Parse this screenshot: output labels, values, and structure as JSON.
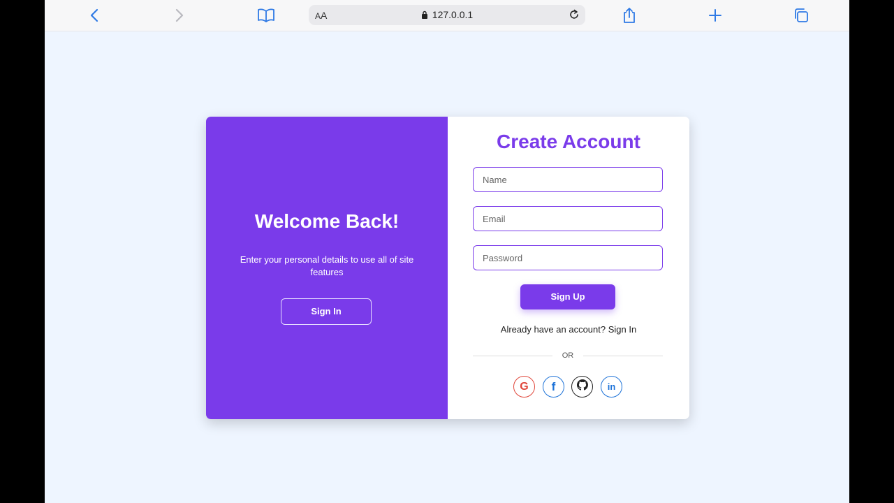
{
  "browser": {
    "address_size_small": "A",
    "address_size_big": "A",
    "url": "127.0.0.1",
    "icons": [
      "chevron-left-icon",
      "chevron-right-icon",
      "book-icon",
      "lock-icon",
      "reload-icon",
      "share-icon",
      "plus-icon",
      "tabs-icon"
    ]
  },
  "left_panel": {
    "title": "Welcome Back!",
    "subtitle": "Enter your personal details to use all of site features",
    "button": "Sign In"
  },
  "right_panel": {
    "title": "Create Account",
    "name_placeholder": "Name",
    "email_placeholder": "Email",
    "password_placeholder": "Password",
    "submit": "Sign Up",
    "already_text": "Already have an account?",
    "already_link": "Sign In",
    "or": "OR",
    "social": [
      {
        "icon": "google-icon",
        "glyph": "G",
        "color": "#e0463a"
      },
      {
        "icon": "facebook-icon",
        "glyph": "f",
        "color": "#1e73d8"
      },
      {
        "icon": "github-icon",
        "glyph": "",
        "color": "#222222"
      },
      {
        "icon": "linkedin-icon",
        "glyph": "in",
        "color": "#1e73d8"
      }
    ]
  },
  "colors": {
    "accent": "#7a3bea",
    "page_bg": "#eef5ff",
    "browser_blue": "#2f7ae5"
  }
}
